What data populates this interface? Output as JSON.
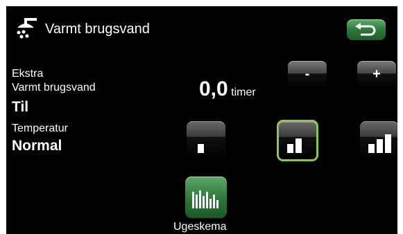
{
  "header": {
    "title": "Varmt brugsvand",
    "icon": "shower-icon",
    "back_icon": "back-arrow-icon"
  },
  "extra": {
    "label_line1": "Ekstra",
    "label_line2": "Varmt brugsvand",
    "state": "Til",
    "value": "0,0",
    "unit": "timer",
    "minus_label": "-",
    "plus_label": "+"
  },
  "temperature": {
    "label": "Temperatur",
    "value": "Normal",
    "options": [
      "low",
      "normal",
      "high"
    ],
    "selected": "normal"
  },
  "schedule": {
    "label": "Ugeskema",
    "icon": "schedule-bars-icon"
  },
  "colors": {
    "background": "#000000",
    "accent_green": "#8fc74a",
    "button_green": "#2e7a3c"
  }
}
